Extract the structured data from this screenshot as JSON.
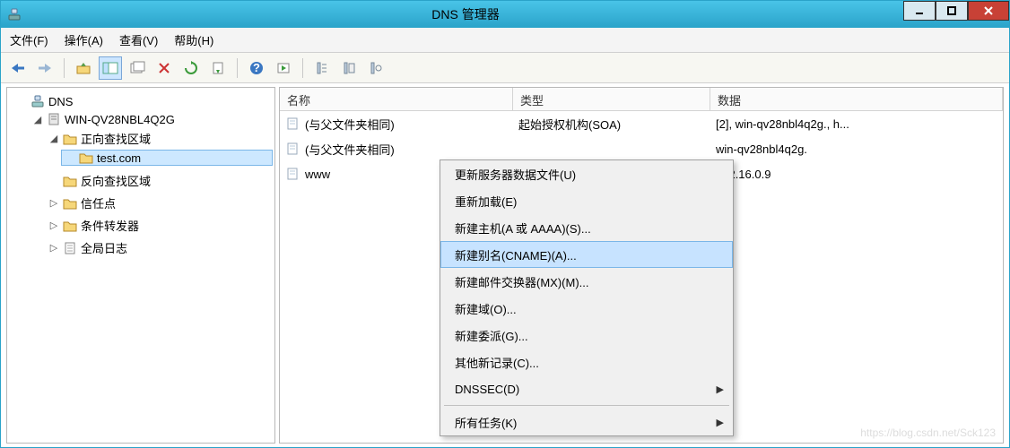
{
  "titlebar": {
    "title": "DNS 管理器"
  },
  "menubar": {
    "items": [
      "文件(F)",
      "操作(A)",
      "查看(V)",
      "帮助(H)"
    ]
  },
  "tree": {
    "root": "DNS",
    "server": "WIN-QV28NBL4Q2G",
    "forward_zone": "正向查找区域",
    "domain": "test.com",
    "reverse_zone": "反向查找区域",
    "trust_point": "信任点",
    "conditional_forwarder": "条件转发器",
    "global_log": "全局日志"
  },
  "list": {
    "columns": {
      "name": "名称",
      "type": "类型",
      "data": "数据"
    },
    "rows": [
      {
        "name": "(与父文件夹相同)",
        "type": "起始授权机构(SOA)",
        "data": "[2], win-qv28nbl4q2g., h..."
      },
      {
        "name": "(与父文件夹相同)",
        "type": "",
        "data": "win-qv28nbl4q2g."
      },
      {
        "name": "www",
        "type": "",
        "data": "172.16.0.9"
      }
    ]
  },
  "context_menu": {
    "items": [
      {
        "label": "更新服务器数据文件(U)",
        "highlight": false
      },
      {
        "label": "重新加载(E)",
        "highlight": false
      },
      {
        "label": "新建主机(A 或 AAAA)(S)...",
        "highlight": false
      },
      {
        "label": "新建别名(CNAME)(A)...",
        "highlight": true
      },
      {
        "label": "新建邮件交换器(MX)(M)...",
        "highlight": false
      },
      {
        "label": "新建域(O)...",
        "highlight": false
      },
      {
        "label": "新建委派(G)...",
        "highlight": false
      },
      {
        "label": "其他新记录(C)...",
        "highlight": false
      },
      {
        "label": "DNSSEC(D)",
        "highlight": false,
        "submenu": true
      },
      {
        "sep": true
      },
      {
        "label": "所有任务(K)",
        "highlight": false,
        "submenu": true
      }
    ]
  },
  "watermark": "https://blog.csdn.net/Sck123"
}
